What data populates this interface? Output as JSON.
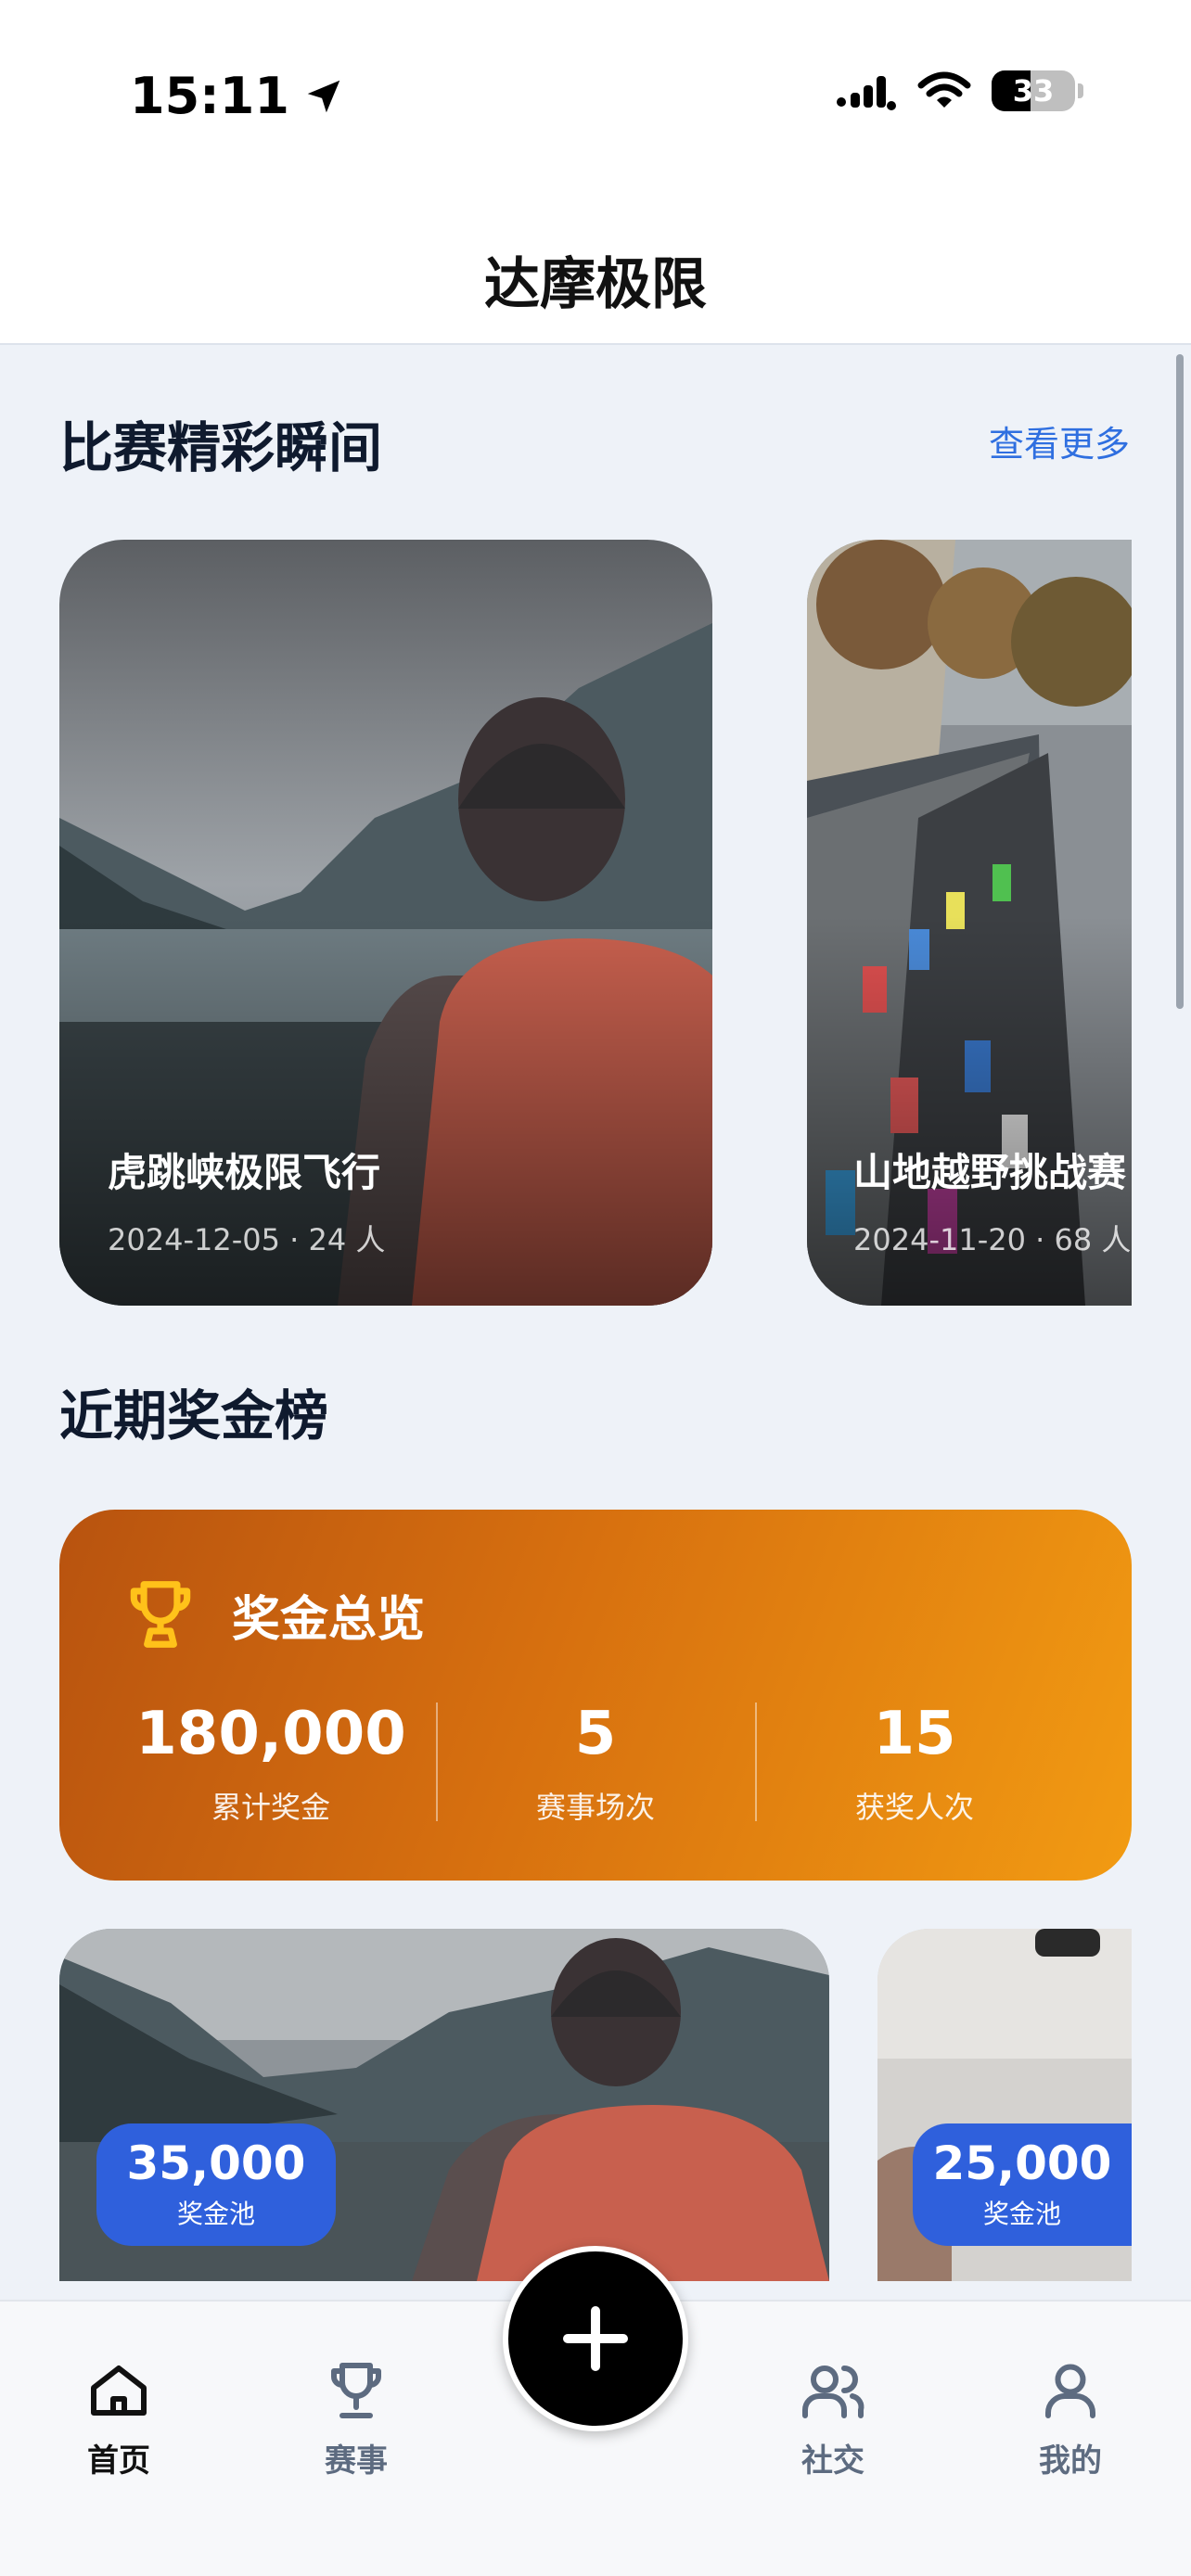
{
  "status_bar": {
    "time": "15:11",
    "battery": "33"
  },
  "header": {
    "title": "达摩极限"
  },
  "highlights": {
    "title": "比赛精彩瞬间",
    "see_more": "查看更多",
    "cards": [
      {
        "title": "虎跳峡极限飞行",
        "meta": "2024-12-05 · 24 人"
      },
      {
        "title": "山地越野挑战赛",
        "meta": "2024-11-20 · 68 人"
      }
    ]
  },
  "prize_board": {
    "title": "近期奖金榜",
    "overview": {
      "title": "奖金总览",
      "stats": [
        {
          "value": "180,000",
          "label": "累计奖金"
        },
        {
          "value": "5",
          "label": "赛事场次"
        },
        {
          "value": "15",
          "label": "获奖人次"
        }
      ]
    },
    "cards": [
      {
        "amount": "35,000",
        "label": "奖金池"
      },
      {
        "amount": "25,000",
        "label": "奖金池"
      }
    ]
  },
  "tabbar": {
    "items": [
      {
        "label": "首页",
        "icon": "home-icon",
        "active": true
      },
      {
        "label": "赛事",
        "icon": "trophy-icon",
        "active": false
      },
      {
        "label": "社交",
        "icon": "users-icon",
        "active": false
      },
      {
        "label": "我的",
        "icon": "user-icon",
        "active": false
      }
    ],
    "fab_icon": "plus-icon"
  },
  "colors": {
    "accent": "#2f6fe0",
    "pool_badge": "#2f60dc",
    "overview_from": "#b8530f",
    "overview_to": "#f29b12",
    "trophy": "#ffc21a"
  }
}
